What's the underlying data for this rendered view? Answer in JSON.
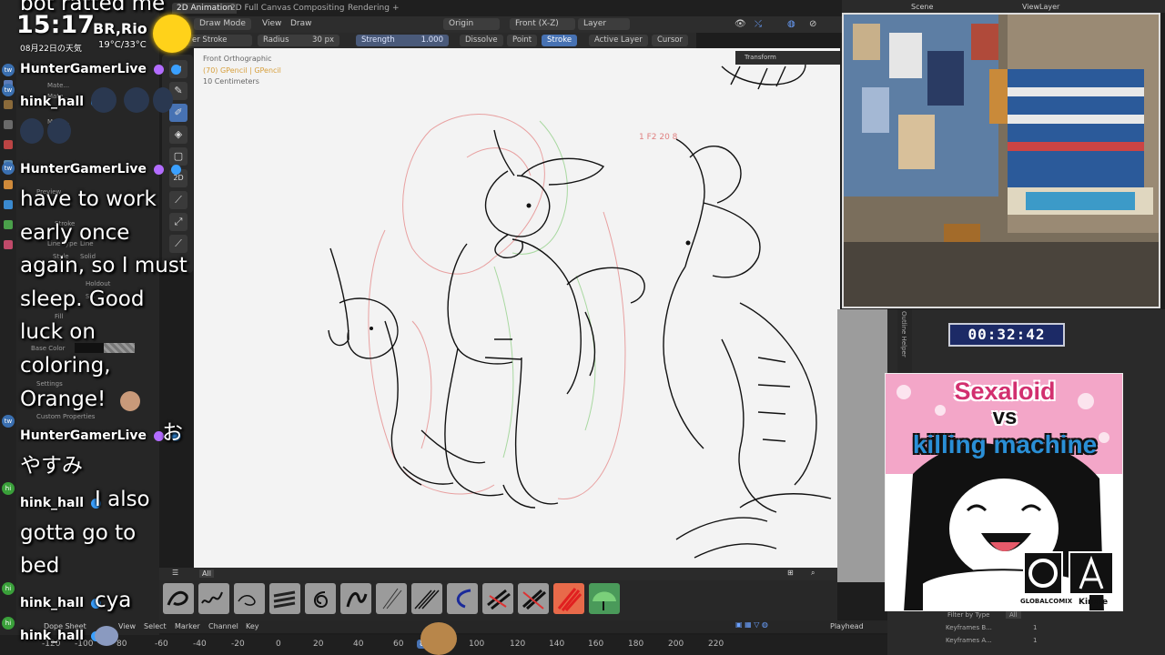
{
  "workspace_tabs": [
    "2D Animation",
    "2D Full Canvas",
    "Compositing",
    "Rendering",
    "+"
  ],
  "header": {
    "mode": "Draw Mode",
    "view": "View",
    "draw": "Draw",
    "origin": "Origin",
    "front": "Front (X-Z)",
    "layer": "Layer"
  },
  "tool_settings": {
    "tool": "er Stroke",
    "radius_label": "Radius",
    "radius_value": "30 px",
    "strength_label": "Strength",
    "strength_value": "1.000",
    "dissolve": "Dissolve",
    "point": "Point",
    "stroke": "Stroke",
    "active_layer": "Active Layer",
    "cursor": "Cursor"
  },
  "viewport_info": {
    "line1": "Front Orthographic",
    "line2": "(70) GPencil | GPencil",
    "line3": "10 Centimeters"
  },
  "viewport_note": "1 F2  20 8",
  "transform_tab": "Transform",
  "properties": {
    "mate1": "Mate...",
    "mate2": "Mate...",
    "mate3": "Mate...",
    "preview": "Preview",
    "stroke": "Stroke",
    "line_type_label": "Line Type",
    "line_type_value": "Line",
    "style_label": "Style",
    "style_value": "Solid",
    "holdout": "Holdout",
    "sel": "Sel",
    "fill": "Fill",
    "base_color": "Base Color",
    "settings": "Settings",
    "custom_props": "Custom Properties"
  },
  "clock": {
    "time": "15:17",
    "city": "BR,Rio",
    "date": "08月22日の天気",
    "temp": "19°C/33°C"
  },
  "chat": {
    "top_line": "bot ratted me",
    "m1_user": "HunterGamerLive",
    "m2_user": "hink_hall",
    "m3_user": "HunterGamerLive",
    "m3_lines": [
      "have to work",
      "early once",
      "again, so I must",
      "sleep. Good",
      "luck on",
      "coloring,",
      "Orange!"
    ],
    "m4_user": "HunterGamerLive",
    "m4_tail": "お",
    "m4_text": "やすみ",
    "m5_user": "hink_hall",
    "m5_first": "I also",
    "m5_lines": [
      "gotta go to",
      "bed"
    ],
    "m6_user": "hink_hall",
    "m6_text": "cya",
    "m7_user": "hink_hall"
  },
  "brushes_tab": "All",
  "timeline": {
    "editor": "Dope Sheet",
    "view": "View",
    "select": "Select",
    "marker": "Marker",
    "channel": "Channel",
    "key": "Key",
    "playhead": "Playhead",
    "ruler": [
      "-120",
      "-100",
      "80",
      "-60",
      "-40",
      "-20",
      "0",
      "20",
      "40",
      "60",
      "80",
      "100",
      "120",
      "140",
      "160",
      "180",
      "200",
      "220"
    ]
  },
  "scene_bar": {
    "scene": "Scene",
    "view_layer": "ViewLayer"
  },
  "timer": "00:32:42",
  "outliner_tab": "Outline Helper",
  "right_filter": {
    "filter": "Filter by Type",
    "all": "All",
    "kf_before": "Keyframes B...",
    "kf_before_val": "1",
    "kf_after": "Keyframes A...",
    "kf_after_val": "1"
  },
  "comic": {
    "title1": "Sexaloid",
    "title2": "vs",
    "title3": "killing machine",
    "brand1": "GLOBALCOMIX",
    "brand2": "Kindle"
  },
  "colors": {
    "accent": "#4772b3",
    "chat_name": "#ffffff",
    "timer_bg": "#1c2a66",
    "comic_pink": "#f3a6c8",
    "brush_active": "#e86a4a",
    "sun": "#ffd21a"
  }
}
